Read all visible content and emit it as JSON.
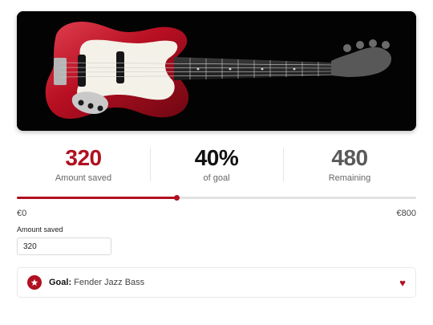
{
  "hero": {
    "image": "bass-guitar-image",
    "background": "#030303"
  },
  "stats": {
    "saved": {
      "value": "320",
      "label": "Amount saved"
    },
    "percent": {
      "value": "40%",
      "label": "of goal"
    },
    "remaining": {
      "value": "480",
      "label": "Remaining"
    }
  },
  "progress": {
    "fraction": 0.4
  },
  "range": {
    "min": "€0",
    "max": "€800"
  },
  "input": {
    "label": "Amount saved",
    "value": "320"
  },
  "goal": {
    "prefix": "Goal:",
    "name": "Fender Jazz Bass",
    "icon": "star-icon",
    "action_icon": "heart-icon"
  },
  "colors": {
    "accent": "#b01020",
    "muted": "#5a5a5a"
  }
}
